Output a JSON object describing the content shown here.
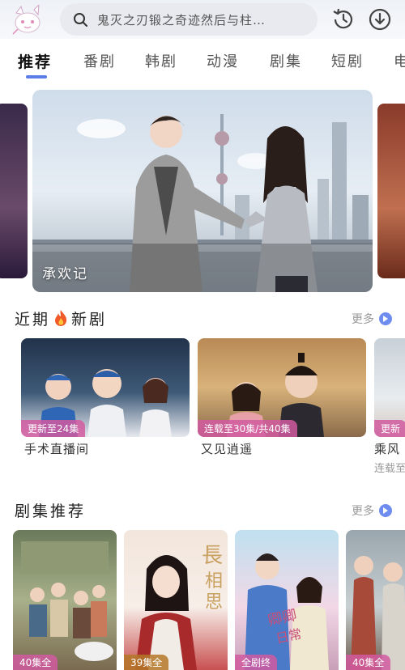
{
  "header": {
    "search_text": "鬼灭之刃锻之奇迹然后与柱…",
    "logo_icon": "anime-mascot-logo",
    "history_icon": "history-clock-icon",
    "download_icon": "download-icon"
  },
  "tabs": [
    "推荐",
    "番剧",
    "韩剧",
    "动漫",
    "剧集",
    "短剧",
    "电"
  ],
  "active_tab": "推荐",
  "banner": {
    "title": "承欢记"
  },
  "recent_section": {
    "title": "近期",
    "title_suffix": "新剧",
    "more": "更多",
    "cards": [
      {
        "title": "手术直播间",
        "badge": "更新至24集",
        "subtitle": ""
      },
      {
        "title": "又见逍遥",
        "badge": "连载至30集/共40集",
        "subtitle": ""
      },
      {
        "title": "乘风",
        "badge": "更新",
        "subtitle": "连载至"
      }
    ]
  },
  "recommend_section": {
    "title": "剧集推荐",
    "more": "更多",
    "posters": [
      {
        "badge": "40集全"
      },
      {
        "badge": "39集全"
      },
      {
        "badge": "全剧终"
      },
      {
        "badge": "40集全"
      }
    ]
  },
  "colors": {
    "accent": "#5b7be8",
    "badge_pink": "#d15aa0"
  }
}
